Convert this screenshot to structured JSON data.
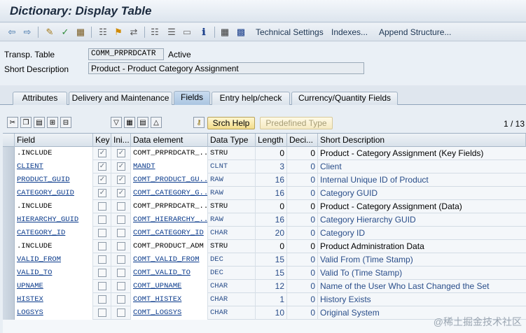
{
  "window": {
    "title": "Dictionary: Display Table"
  },
  "toolbar": {
    "icons": [
      "back-arrow-icon",
      "forward-arrow-icon",
      "display-change-icon",
      "check-icon",
      "object-list-icon",
      "hierarchy-icon",
      "where-used-icon",
      "graphic-icon",
      "tree-icon",
      "window-icon",
      "info-icon",
      "table-icon",
      "grid-icon"
    ],
    "technical_settings": "Technical Settings",
    "indexes": "Indexes...",
    "append_structure": "Append Structure..."
  },
  "header": {
    "transp_table_label": "Transp. Table",
    "transp_table_value": "COMM_PRPRDCATR",
    "status": "Active",
    "short_desc_label": "Short Description",
    "short_desc_value": "Product - Product Category Assignment"
  },
  "tabs": [
    {
      "label": "Attributes"
    },
    {
      "label": "Delivery and Maintenance"
    },
    {
      "label": "Fields"
    },
    {
      "label": "Entry help/check"
    },
    {
      "label": "Currency/Quantity Fields"
    }
  ],
  "table_toolbar": {
    "srch_help": "Srch Help",
    "predefined_type": "Predefined Type",
    "pager": "1 / 13"
  },
  "columns": [
    "Field",
    "Key",
    "Ini...",
    "Data element",
    "Data Type",
    "Length",
    "Deci...",
    "Short Description"
  ],
  "rows": [
    {
      "field": ".INCLUDE",
      "key": true,
      "ini": true,
      "element": "COMT_PRPRDCATR_...",
      "type": "STRU",
      "length": "0",
      "deci": "0",
      "desc": "Product - Category Assignment (Key Fields)",
      "link": false
    },
    {
      "field": "CLIENT",
      "key": true,
      "ini": true,
      "element": "MANDT",
      "type": "CLNT",
      "length": "3",
      "deci": "0",
      "desc": "Client",
      "link": true
    },
    {
      "field": "PRODUCT_GUID",
      "key": true,
      "ini": true,
      "element": "COMT_PRODUCT_GU...",
      "type": "RAW",
      "length": "16",
      "deci": "0",
      "desc": "Internal Unique ID of Product",
      "link": true
    },
    {
      "field": "CATEGORY_GUID",
      "key": true,
      "ini": true,
      "element": "COMT_CATEGORY_G...",
      "type": "RAW",
      "length": "16",
      "deci": "0",
      "desc": "Category GUID",
      "link": true
    },
    {
      "field": ".INCLUDE",
      "key": false,
      "ini": false,
      "element": "COMT_PRPRDCATR_...",
      "type": "STRU",
      "length": "0",
      "deci": "0",
      "desc": "Product - Category Assignment (Data)",
      "link": false
    },
    {
      "field": "HIERARCHY_GUID",
      "key": false,
      "ini": false,
      "element": "COMT_HIERARCHY_...",
      "type": "RAW",
      "length": "16",
      "deci": "0",
      "desc": "Category Hierarchy GUID",
      "link": true
    },
    {
      "field": "CATEGORY_ID",
      "key": false,
      "ini": false,
      "element": "COMT_CATEGORY_ID",
      "type": "CHAR",
      "length": "20",
      "deci": "0",
      "desc": "Category ID",
      "link": true
    },
    {
      "field": ".INCLUDE",
      "key": false,
      "ini": false,
      "element": "COMT_PRODUCT_ADM",
      "type": "STRU",
      "length": "0",
      "deci": "0",
      "desc": "Product Administration Data",
      "link": false
    },
    {
      "field": "VALID_FROM",
      "key": false,
      "ini": false,
      "element": "COMT_VALID_FROM",
      "type": "DEC",
      "length": "15",
      "deci": "0",
      "desc": "Valid From (Time Stamp)",
      "link": true
    },
    {
      "field": "VALID_TO",
      "key": false,
      "ini": false,
      "element": "COMT_VALID_TO",
      "type": "DEC",
      "length": "15",
      "deci": "0",
      "desc": "Valid To (Time Stamp)",
      "link": true
    },
    {
      "field": "UPNAME",
      "key": false,
      "ini": false,
      "element": "COMT_UPNAME",
      "type": "CHAR",
      "length": "12",
      "deci": "0",
      "desc": "Name of the User Who Last Changed the Set",
      "link": true
    },
    {
      "field": "HISTEX",
      "key": false,
      "ini": false,
      "element": "COMT_HISTEX",
      "type": "CHAR",
      "length": "1",
      "deci": "0",
      "desc": "History Exists",
      "link": true
    },
    {
      "field": "LOGSYS",
      "key": false,
      "ini": false,
      "element": "COMT_LOGSYS",
      "type": "CHAR",
      "length": "10",
      "deci": "0",
      "desc": "Original System",
      "link": true
    }
  ],
  "watermark": "@稀土掘金技术社区"
}
